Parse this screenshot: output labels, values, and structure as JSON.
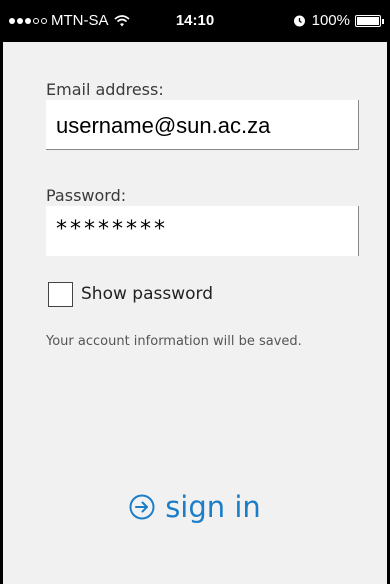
{
  "status_bar": {
    "carrier": "MTN-SA",
    "time": "14:10",
    "battery": "100%",
    "battery_level_percent": 100,
    "signal_bars_filled": 3,
    "signal_bars_total": 5,
    "icons": [
      "signal-dots",
      "wifi-icon",
      "alarm-icon",
      "battery-icon"
    ]
  },
  "form": {
    "email_label": "Email address:",
    "email_value": "username@sun.ac.za",
    "password_label": "Password:",
    "password_value": "********",
    "show_password_label": "Show password",
    "show_password_checked": false,
    "info_text": "Your account information will be saved."
  },
  "actions": {
    "signin_label": "sign in",
    "signin_icon": "arrow-circle-right-icon"
  },
  "colors": {
    "accent": "#1c7ec8",
    "background": "#f1f1f1",
    "status_bar": "#000000"
  }
}
